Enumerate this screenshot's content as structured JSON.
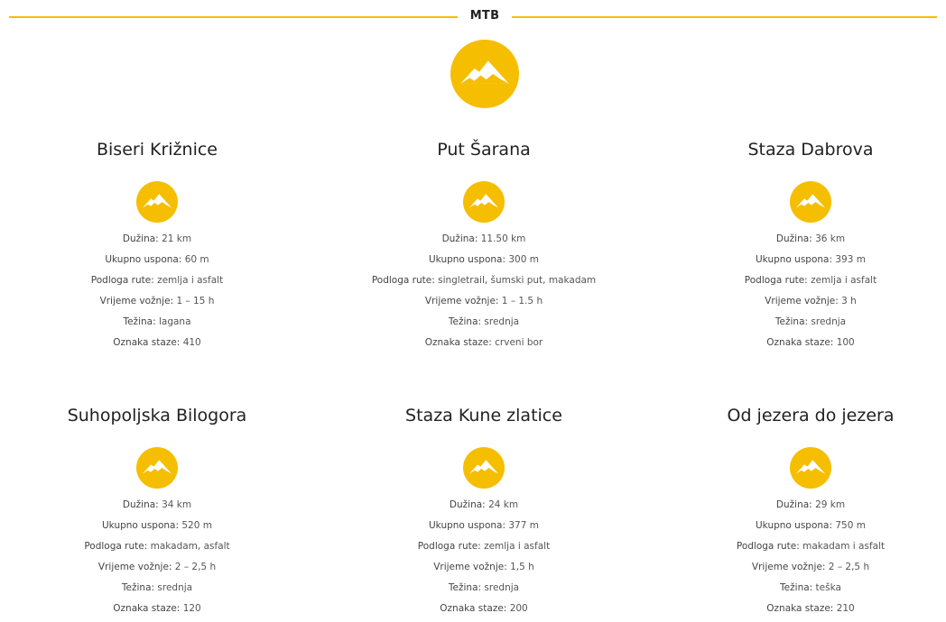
{
  "section": {
    "title": "MTB",
    "icon": "mountain-icon",
    "accent_color": "#f6be00"
  },
  "routes": [
    {
      "name": "Biseri Križnice",
      "icon": "mountain-icon",
      "duzina_label": "Dužina:",
      "duzina": "21 km",
      "uspon_label": "Ukupno uspona:",
      "uspon": "60 m",
      "podloga_label": "Podloga rute:",
      "podloga": "zemlja i asfalt",
      "vrijeme_label": "Vrijeme vožnje:",
      "vrijeme": "1 – 15 h",
      "tezina_label": "Težina:",
      "tezina": "lagana",
      "oznaka_label": "Oznaka staze:",
      "oznaka": "410"
    },
    {
      "name": "Put Šarana",
      "icon": "mountain-icon",
      "duzina_label": "Dužina:",
      "duzina": "11.50 km",
      "uspon_label": "Ukupno uspona:",
      "uspon": "300 m",
      "podloga_label": "Podloga rute:",
      "podloga": "singletrail, šumski put, makadam",
      "vrijeme_label": "Vrijeme vožnje:",
      "vrijeme": "1 – 1.5 h",
      "tezina_label": "Težina:",
      "tezina": "srednja",
      "oznaka_label": "Oznaka staze:",
      "oznaka": "crveni bor"
    },
    {
      "name": "Staza Dabrova",
      "icon": "mountain-icon",
      "duzina_label": "Dužina:",
      "duzina": "36 km",
      "uspon_label": "Ukupno uspona:",
      "uspon": "393 m",
      "podloga_label": "Podloga rute:",
      "podloga": "zemlja i asfalt",
      "vrijeme_label": "Vrijeme vožnje:",
      "vrijeme": "3 h",
      "tezina_label": "Težina:",
      "tezina": "srednja",
      "oznaka_label": "Oznaka staze:",
      "oznaka": "100"
    },
    {
      "name": "Suhopoljska Bilogora",
      "icon": "mountain-icon",
      "duzina_label": "Dužina:",
      "duzina": "34 km",
      "uspon_label": "Ukupno uspona:",
      "uspon": "520 m",
      "podloga_label": "Podloga rute:",
      "podloga": "makadam, asfalt",
      "vrijeme_label": "Vrijeme vožnje:",
      "vrijeme": "2 – 2,5 h",
      "tezina_label": "Težina:",
      "tezina": "srednja",
      "oznaka_label": "Oznaka staze:",
      "oznaka": "120"
    },
    {
      "name": "Staza Kune zlatice",
      "icon": "mountain-icon",
      "duzina_label": "Dužina:",
      "duzina": "24 km",
      "uspon_label": "Ukupno uspona:",
      "uspon": "377 m",
      "podloga_label": "Podloga rute:",
      "podloga": "zemlja i asfalt",
      "vrijeme_label": "Vrijeme vožnje:",
      "vrijeme": "1,5 h",
      "tezina_label": "Težina:",
      "tezina": "srednja",
      "oznaka_label": "Oznaka staze:",
      "oznaka": "200"
    },
    {
      "name": "Od jezera do jezera",
      "icon": "mountain-icon",
      "duzina_label": "Dužina:",
      "duzina": "29 km",
      "uspon_label": "Ukupno uspona:",
      "uspon": "750 m",
      "podloga_label": "Podloga rute:",
      "podloga": "makadam i asfalt",
      "vrijeme_label": "Vrijeme vožnje:",
      "vrijeme": "2 – 2,5 h",
      "tezina_label": "Težina:",
      "tezina": "teška",
      "oznaka_label": "Oznaka staze:",
      "oznaka": "210"
    }
  ]
}
